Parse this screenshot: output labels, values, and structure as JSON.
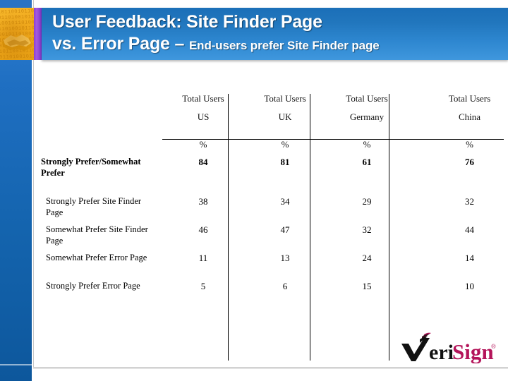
{
  "slide": {
    "title_line1": "User Feedback: Site Finder Page",
    "title_line2": "vs. Error Page – ",
    "title_subtitle": "End-users prefer Site Finder page",
    "banner_color": "#2176bd",
    "rail_color": "#1464ae",
    "accent_purple": "#8a3fd4",
    "accent_gold": "#f0a81c"
  },
  "decor": {
    "hero_alt": "handshake-binary-image",
    "binary_rows": [
      "10110010110101",
      "01101001011010",
      "10010110100101",
      "11010010110100",
      "00101101001011",
      "10110100101101",
      "01001011010010",
      "10110010110101",
      "01101001011010"
    ]
  },
  "table": {
    "group_header": "Total Users",
    "columns": [
      {
        "group": "Total Users",
        "region": "US",
        "unit": "%"
      },
      {
        "group": "Total Users",
        "region": "UK",
        "unit": "%"
      },
      {
        "group": "Total Users",
        "region": "Germany",
        "unit": "%"
      },
      {
        "group": "Total Users",
        "region": "China",
        "unit": "%"
      }
    ],
    "rows": [
      {
        "label": "Strongly Prefer/Somewhat Prefer",
        "bold": true,
        "indent": false,
        "values": [
          "84",
          "81",
          "61",
          "76"
        ]
      },
      {
        "label": "Strongly Prefer Site Finder Page",
        "bold": false,
        "indent": true,
        "values": [
          "38",
          "34",
          "29",
          "32"
        ]
      },
      {
        "label": "Somewhat Prefer Site Finder Page",
        "bold": false,
        "indent": true,
        "values": [
          "46",
          "47",
          "32",
          "44"
        ]
      },
      {
        "label": "Somewhat Prefer Error Page",
        "bold": false,
        "indent": true,
        "values": [
          "11",
          "13",
          "24",
          "14"
        ]
      },
      {
        "label": "Strongly Prefer Error Page",
        "bold": false,
        "indent": true,
        "values": [
          "5",
          "6",
          "15",
          "10"
        ]
      }
    ]
  },
  "logo": {
    "name": "VeriSign",
    "part_dark": "eri",
    "part_accent": "Sign",
    "trademark": "®",
    "dark_color": "#111111",
    "accent_color": "#b4145a"
  },
  "chart_data": {
    "type": "table",
    "title": "User Feedback: Site Finder Page vs. Error Page",
    "subtitle": "End-users prefer Site Finder page",
    "categories": [
      "US",
      "UK",
      "Germany",
      "China"
    ],
    "unit": "%",
    "series": [
      {
        "name": "Strongly Prefer/Somewhat Prefer",
        "values": [
          84,
          81,
          61,
          76
        ]
      },
      {
        "name": "Strongly Prefer Site Finder Page",
        "values": [
          38,
          34,
          29,
          32
        ]
      },
      {
        "name": "Somewhat Prefer Site Finder Page",
        "values": [
          46,
          47,
          32,
          44
        ]
      },
      {
        "name": "Somewhat Prefer Error Page",
        "values": [
          11,
          13,
          24,
          14
        ]
      },
      {
        "name": "Strongly Prefer Error Page",
        "values": [
          5,
          6,
          15,
          10
        ]
      }
    ],
    "xlabel": "Total Users",
    "ylabel": "%",
    "grid": false,
    "legend": "none"
  }
}
